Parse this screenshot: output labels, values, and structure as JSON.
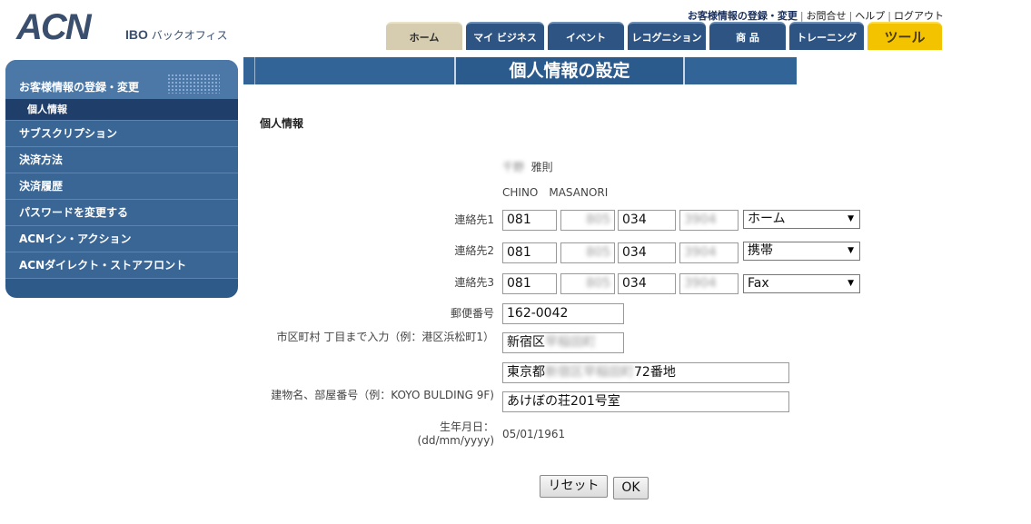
{
  "brand": {
    "logo": "ACN",
    "ibo": "IBO",
    "subtitle": "バックオフィス"
  },
  "toplinks": [
    "お客様情報の登録・変更",
    "お問合せ",
    "ヘルプ",
    "ログアウト"
  ],
  "tabs": [
    "ホーム",
    "マイ ビジネス",
    "イベント",
    "レコグニション",
    "商 品",
    "トレーニング",
    "ツール"
  ],
  "sidebar": {
    "header": "お客様情報の登録・変更",
    "items": [
      "個人情報",
      "サブスクリプション",
      "決済方法",
      "決済履歴",
      "パスワードを変更する",
      "ACNイン・アクション",
      "ACNダイレクト・ストアフロント"
    ]
  },
  "page": {
    "title": "個人情報の設定",
    "section": "個人情報"
  },
  "form": {
    "name_kanji_last": "千野",
    "name_kanji_first": "雅則",
    "name_romaji": "CHINO　MASANORI",
    "contact1": {
      "label": "連絡先1",
      "p1": "081",
      "p2": "805",
      "p3": "034",
      "p4": "3904",
      "type": "ホーム"
    },
    "contact2": {
      "label": "連絡先2",
      "p1": "081",
      "p2": "805",
      "p3": "034",
      "p4": "3904",
      "type": "携帯"
    },
    "contact3": {
      "label": "連絡先3",
      "p1": "081",
      "p2": "805",
      "p3": "034",
      "p4": "3904",
      "type": "Fax"
    },
    "postal_label": "郵便番号",
    "postal": "162-0042",
    "city_label": "市区町村 丁目まで入力（例：港区浜松町1）",
    "city_prefix": "新宿区",
    "city_hidden": "早稲田町",
    "address_prefix": "東京都",
    "address_hidden": "新宿区早稲田町",
    "address_suffix": "72番地",
    "building_label": "建物名、部屋番号（例：KOYO BULDING 9F)",
    "building": "あけぼの荘201号室",
    "dob_label": "生年月日：(dd/mm/yyyy)",
    "dob": "05/01/1961"
  },
  "buttons": {
    "reset": "リセット",
    "ok": "OK"
  }
}
